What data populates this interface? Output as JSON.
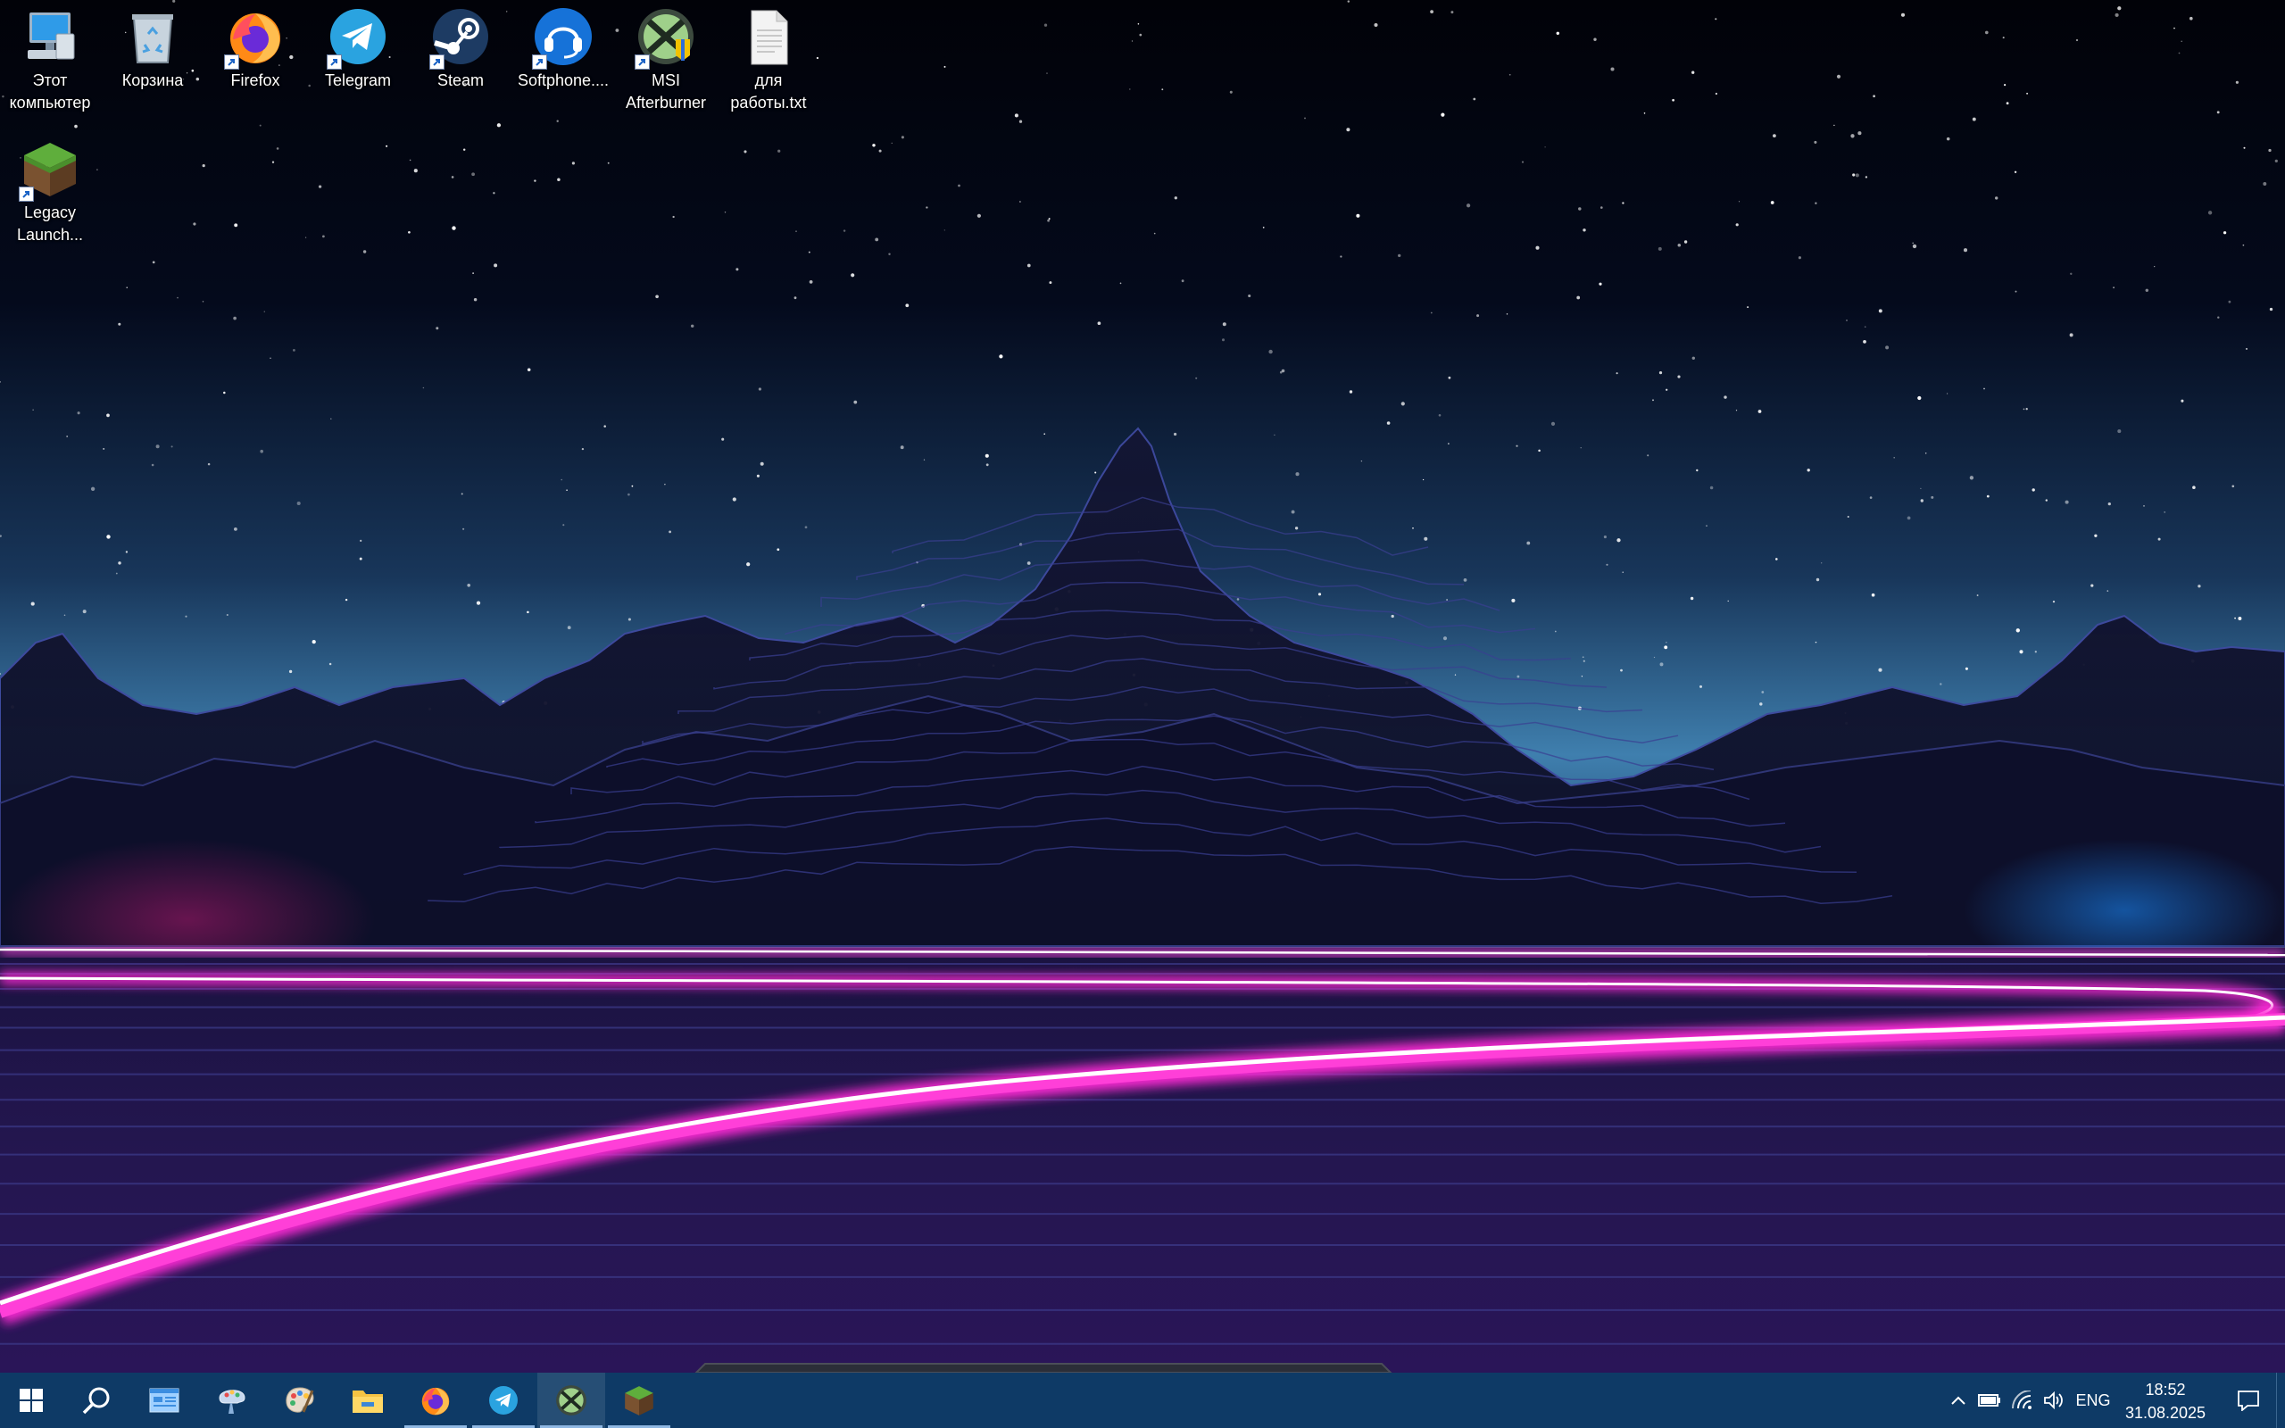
{
  "desktop": {
    "icons": [
      {
        "label": "Этот\nкомпьютер",
        "icon": "this-pc-icon"
      },
      {
        "label": "Корзина",
        "icon": "recycle-bin-icon"
      },
      {
        "label": "Firefox",
        "icon": "firefox-icon"
      },
      {
        "label": "Telegram",
        "icon": "telegram-icon"
      },
      {
        "label": "Steam",
        "icon": "steam-icon"
      },
      {
        "label": "Softphone....",
        "icon": "softphone-icon"
      },
      {
        "label": "MSI\nAfterburner",
        "icon": "msi-afterburner-icon"
      },
      {
        "label": "для\nработы.txt",
        "icon": "text-file-icon"
      },
      {
        "label": "Legacy\nLaunch...",
        "icon": "minecraft-launcher-icon"
      }
    ]
  },
  "taskbar": {
    "apps": [
      {
        "icon": "start-windows-icon"
      },
      {
        "icon": "search-icon"
      },
      {
        "icon": "app-window-icon"
      },
      {
        "icon": "paint-3d-icon"
      },
      {
        "icon": "palette-icon"
      },
      {
        "icon": "file-explorer-icon"
      },
      {
        "icon": "firefox-icon"
      },
      {
        "icon": "telegram-icon"
      },
      {
        "icon": "msi-afterburner-icon"
      },
      {
        "icon": "minecraft-launcher-icon"
      }
    ],
    "tray": {
      "language": "ENG",
      "time": "18:52",
      "date": "31.08.2025",
      "icons": [
        "show-hidden-icons-chevron",
        "battery-icon",
        "wifi-icon",
        "volume-icon",
        "notifications-icon"
      ]
    }
  },
  "colors": {
    "taskbar": "#0e3a66",
    "neon_magenta": "#ff2bd6",
    "sky_glow": "#5fa6d8"
  }
}
